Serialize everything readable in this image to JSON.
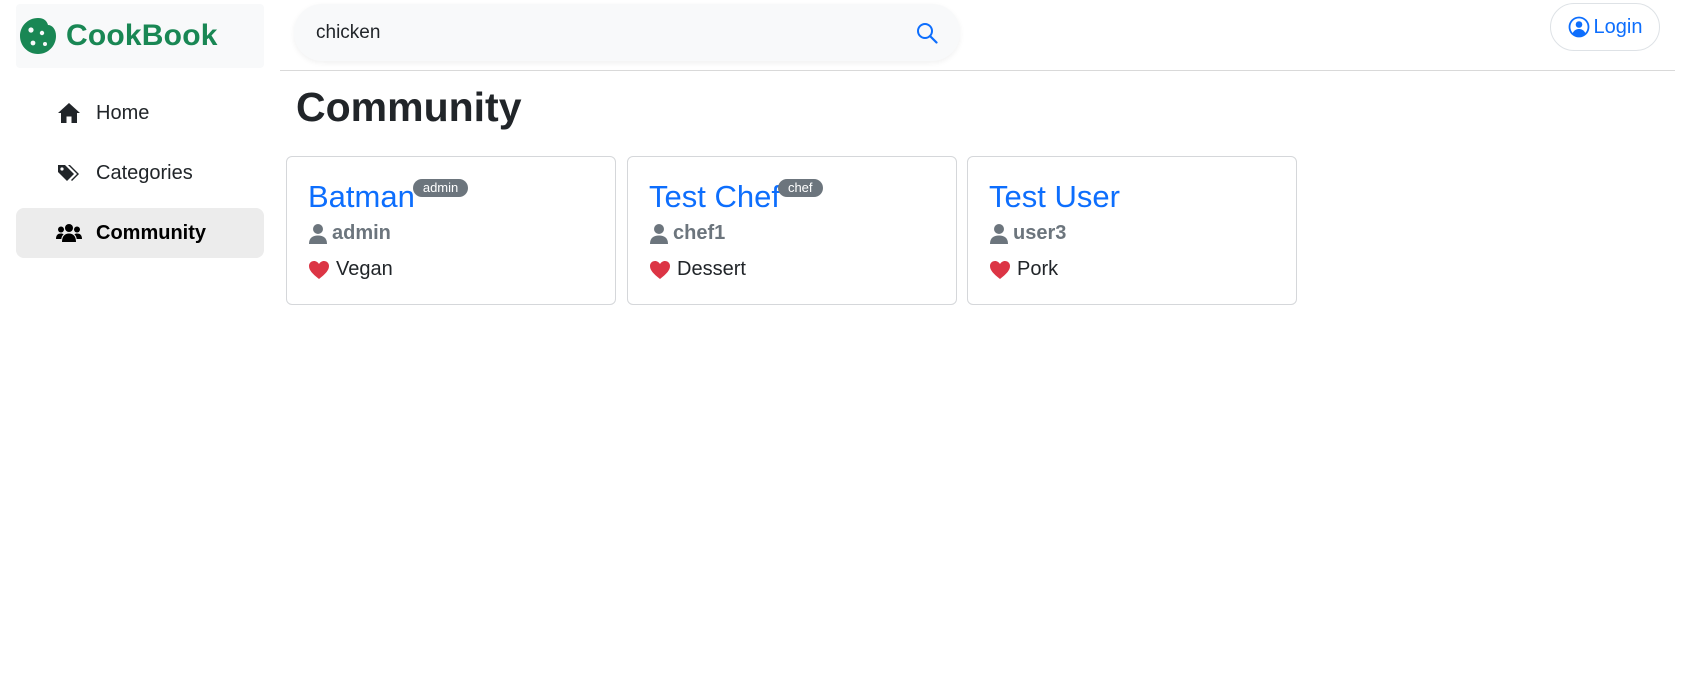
{
  "brand": {
    "name": "CookBook",
    "logo": "cookie-logo",
    "color": "#198754"
  },
  "nav": {
    "items": [
      {
        "label": "Home",
        "icon": "house-icon",
        "active": false
      },
      {
        "label": "Categories",
        "icon": "tags-icon",
        "active": false
      },
      {
        "label": "Community",
        "icon": "people-icon",
        "active": true
      }
    ]
  },
  "search": {
    "value": "chicken",
    "icon": "search-icon"
  },
  "header": {
    "login_label": "Login",
    "login_icon": "person-circle-icon"
  },
  "main": {
    "title": "Community",
    "users": [
      {
        "name": "Batman",
        "badge": "admin",
        "username": "admin",
        "favorite": "Vegan"
      },
      {
        "name": "Test Chef",
        "badge": "chef",
        "username": "chef1",
        "favorite": "Dessert"
      },
      {
        "name": "Test User",
        "badge": "",
        "username": "user3",
        "favorite": "Pork"
      }
    ]
  },
  "colors": {
    "accent": "#0d6efd",
    "badge": "#6c757d",
    "heart": "#dc3545",
    "active_nav_bg": "#ececec"
  }
}
